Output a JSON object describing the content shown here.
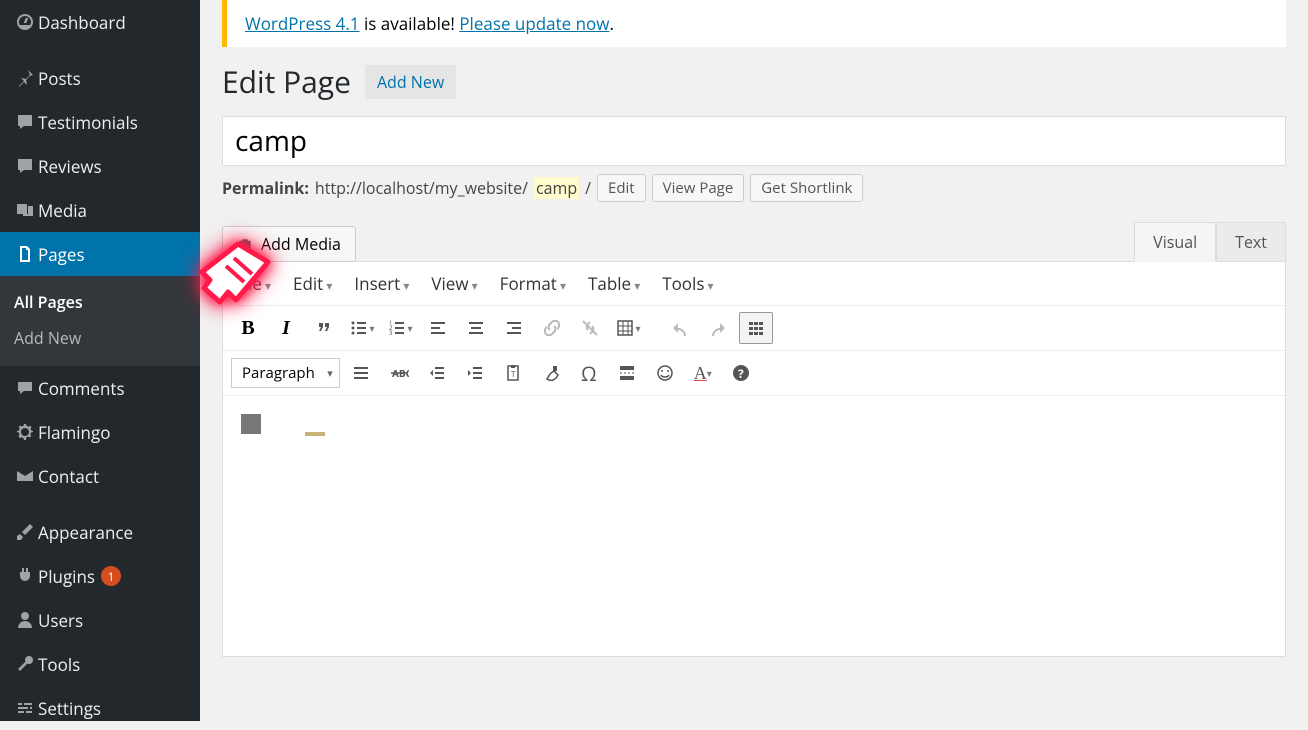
{
  "sidebar": {
    "items": [
      {
        "label": "Dashboard"
      },
      {
        "label": "Posts"
      },
      {
        "label": "Testimonials"
      },
      {
        "label": "Reviews"
      },
      {
        "label": "Media"
      },
      {
        "label": "Pages"
      },
      {
        "label": "Comments"
      },
      {
        "label": "Flamingo"
      },
      {
        "label": "Contact"
      },
      {
        "label": "Appearance"
      },
      {
        "label": "Plugins"
      },
      {
        "label": "Users"
      },
      {
        "label": "Tools"
      },
      {
        "label": "Settings"
      }
    ],
    "submenu": {
      "all": "All Pages",
      "add": "Add New"
    },
    "plugin_updates": "1"
  },
  "notice": {
    "link1": "WordPress 4.1",
    "middle": " is available! ",
    "link2": "Please update now",
    "end": "."
  },
  "heading": {
    "title": "Edit Page",
    "addnew": "Add New"
  },
  "post": {
    "title": "camp",
    "permalink_label": "Permalink:",
    "permalink_base": "http://localhost/my_website/",
    "permalink_slug": "camp",
    "permalink_trail": "/",
    "edit_btn": "Edit",
    "view_btn": "View Page",
    "shortlink_btn": "Get Shortlink"
  },
  "editor": {
    "add_media": "Add Media",
    "tabs": {
      "visual": "Visual",
      "text": "Text"
    },
    "menubar": [
      "File",
      "Edit",
      "Insert",
      "View",
      "Format",
      "Table",
      "Tools"
    ],
    "block_format": "Paragraph"
  }
}
